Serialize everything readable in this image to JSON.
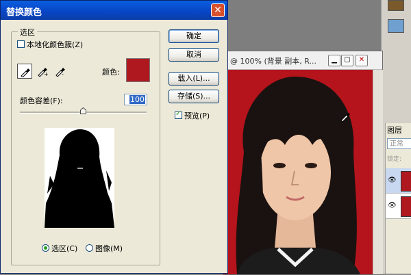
{
  "dialog": {
    "title": "替换颜色",
    "selection_group_label": "选区",
    "localized_clusters_label": "本地化颜色簇(Z)",
    "localized_clusters_checked": false,
    "color_label": "颜色:",
    "color_value": "#b01820",
    "fuzziness_label": "颜色容差(F):",
    "fuzziness_value": "100",
    "radio_selection_label": "选区(C)",
    "radio_image_label": "图像(M)",
    "radio_selected": "selection",
    "buttons": {
      "ok": "确定",
      "cancel": "取消",
      "load": "载入(L)...",
      "save": "存储(S)...",
      "preview_label": "预览(P)",
      "preview_checked": true
    }
  },
  "document": {
    "title": "@ 100% (背景 副本, R..."
  },
  "layers": {
    "tab_label": "图层",
    "blend_mode": "正常",
    "lock_label": "锁定:"
  },
  "colors": {
    "accent_titlebar": "#0a5ee0",
    "background_red": "#b5141c"
  },
  "icons": [
    "eyedropper-icon",
    "eyedropper-plus-icon",
    "eyedropper-minus-icon",
    "close-icon",
    "minimize-icon",
    "maximize-icon",
    "eye-icon",
    "slider-thumb-icon"
  ]
}
